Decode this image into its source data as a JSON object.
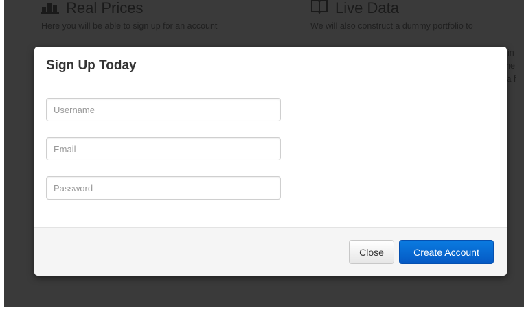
{
  "background": {
    "left_column": {
      "icon": "bar-chart-icon",
      "heading": "Real Prices",
      "text": "Here you will be able to sign up for an account"
    },
    "right_column": {
      "icon": "book-icon",
      "heading": "Live Data",
      "text": "We will also construct a dummy portfolio to",
      "fragments": [
        "t in",
        "he",
        "ta f"
      ]
    }
  },
  "modal": {
    "title": "Sign Up Today",
    "fields": {
      "username_placeholder": "Username",
      "email_placeholder": "Email",
      "password_placeholder": "Password"
    },
    "buttons": {
      "close": "Close",
      "create": "Create Account"
    }
  },
  "colors": {
    "overlay": "#3a3a3a",
    "primary": "#0a6cd6"
  }
}
